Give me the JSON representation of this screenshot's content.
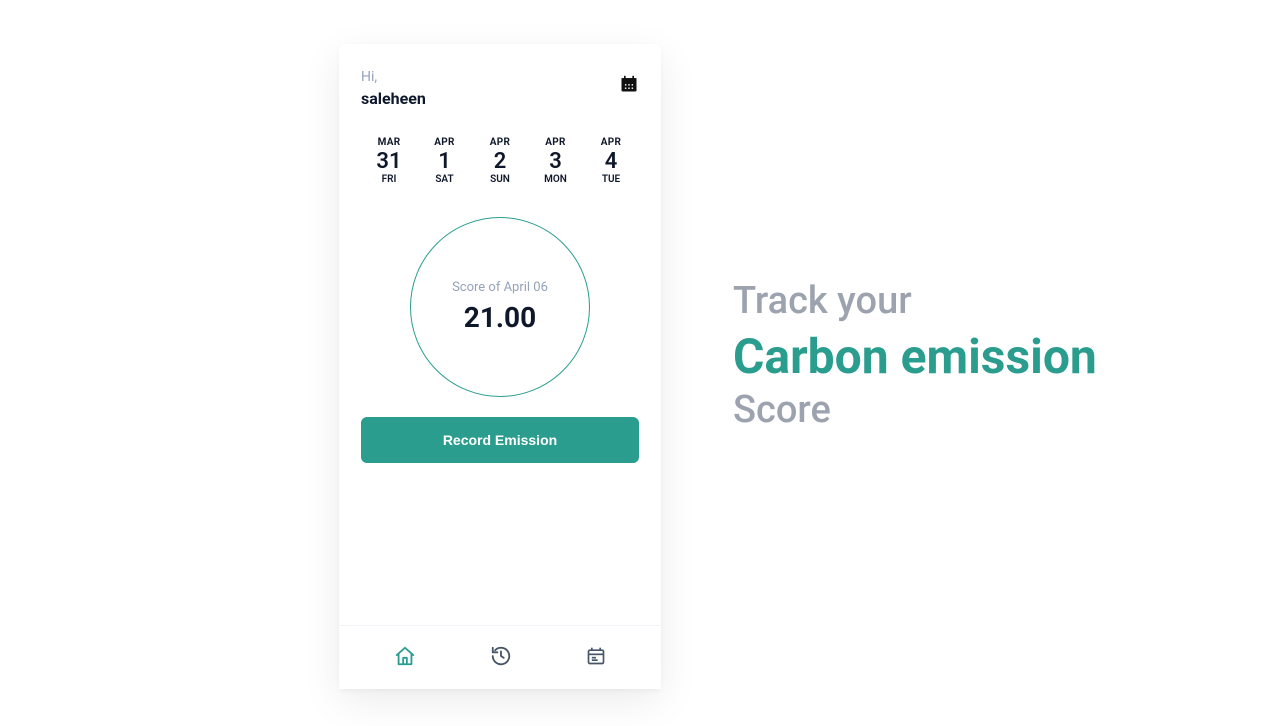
{
  "colors": {
    "accent": "#2a9d8f",
    "muted": "#9ca3af",
    "dark": "#0f172a"
  },
  "header": {
    "hi": "Hi,",
    "name": "saleheen"
  },
  "dates": [
    {
      "month": "MAR",
      "day": "31",
      "dow": "FRI"
    },
    {
      "month": "APR",
      "day": "1",
      "dow": "SAT"
    },
    {
      "month": "APR",
      "day": "2",
      "dow": "SUN"
    },
    {
      "month": "APR",
      "day": "3",
      "dow": "MON"
    },
    {
      "month": "APR",
      "day": "4",
      "dow": "TUE"
    }
  ],
  "circle": {
    "label": "Score of April 06",
    "score": "21.00"
  },
  "button": {
    "record": "Record Emission"
  },
  "nav": {
    "home": "home-icon",
    "history": "history-icon",
    "calendar": "calendar-list-icon"
  },
  "tagline": {
    "line1": "Track your",
    "line2": "Carbon emission",
    "line3": "Score"
  }
}
